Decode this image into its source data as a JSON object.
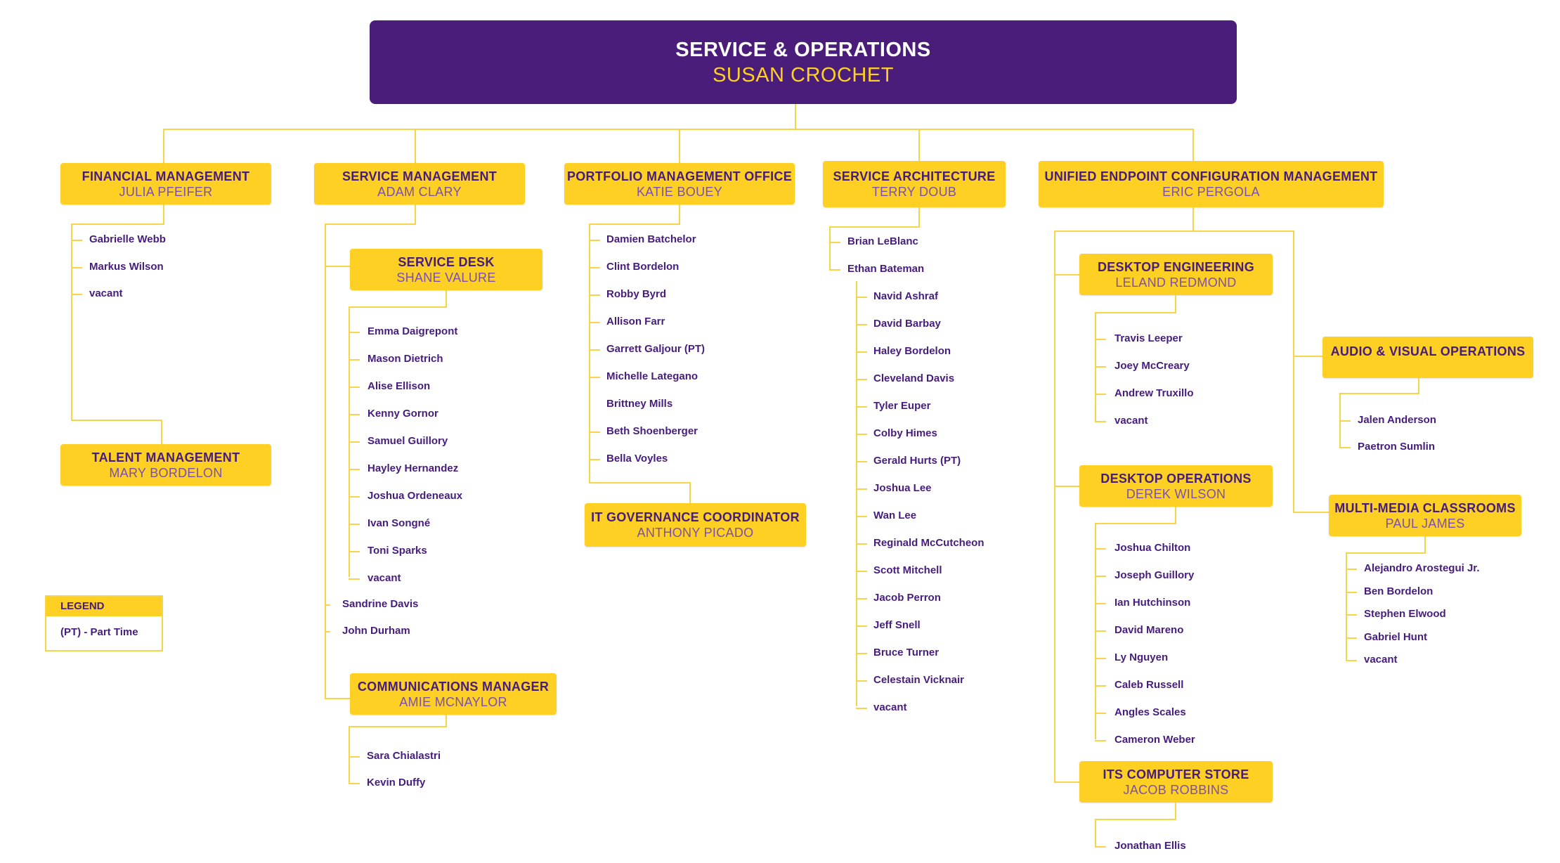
{
  "colors": {
    "header_bg": "#4a1d7a",
    "gold": "#fdd023",
    "text_purple": "#461d7c",
    "name_purple": "#7b4fb0",
    "connector": "#f7d44a"
  },
  "root": {
    "title": "SERVICE & OPERATIONS",
    "name": "SUSAN CROCHET"
  },
  "financial": {
    "title": "FINANCIAL MANAGEMENT",
    "name": "JULIA PFEIFER",
    "members": [
      "Gabrielle Webb",
      "Markus Wilson",
      "vacant"
    ],
    "talent": {
      "title": "TALENT MANAGEMENT",
      "name": "MARY BORDELON"
    }
  },
  "service_mgmt": {
    "title": "SERVICE MANAGEMENT",
    "name": "ADAM CLARY",
    "service_desk": {
      "title": "SERVICE DESK",
      "name": "SHANE VALURE",
      "members": [
        "Emma Daigrepont",
        "Mason Dietrich",
        "Alise Ellison",
        "Kenny Gornor",
        "Samuel Guillory",
        "Hayley Hernandez",
        "Joshua Ordeneaux",
        "Ivan Songné",
        "Toni Sparks",
        "vacant"
      ]
    },
    "members": [
      "Sandrine Davis",
      "John Durham"
    ],
    "comms": {
      "title": "COMMUNICATIONS MANAGER",
      "name": "AMIE MCNAYLOR",
      "members": [
        "Sara Chialastri",
        "Kevin Duffy"
      ]
    }
  },
  "pmo": {
    "title": "PORTFOLIO MANAGEMENT OFFICE",
    "name": "KATIE BOUEY",
    "members": [
      "Damien Batchelor",
      "Clint Bordelon",
      "Robby Byrd",
      "Allison Farr",
      "Garrett Galjour (PT)",
      "Michelle Lategano",
      "Brittney Mills",
      "Beth Shoenberger",
      "Bella Voyles"
    ],
    "itgov": {
      "title": "IT GOVERNANCE COORDINATOR",
      "name": "ANTHONY PICADO"
    }
  },
  "architecture": {
    "title": "SERVICE ARCHITECTURE",
    "name": "TERRY DOUB",
    "members": [
      "Brian LeBlanc",
      "Ethan Bateman"
    ],
    "sub_members": [
      "Navid Ashraf",
      "David Barbay",
      "Haley Bordelon",
      "Cleveland Davis",
      "Tyler Euper",
      "Colby Himes",
      "Gerald Hurts (PT)",
      "Joshua Lee",
      "Wan Lee",
      "Reginald McCutcheon",
      "Scott Mitchell",
      "Jacob Perron",
      "Jeff Snell",
      "Bruce Turner",
      "Celestain Vicknair",
      "vacant"
    ]
  },
  "uecm": {
    "title": "UNIFIED ENDPOINT CONFIGURATION MANAGEMENT",
    "name": "ERIC PERGOLA",
    "desktop_eng": {
      "title": "DESKTOP ENGINEERING",
      "name": "LELAND REDMOND",
      "members": [
        "Travis Leeper",
        "Joey McCreary",
        "Andrew Truxillo",
        "vacant"
      ]
    },
    "desktop_ops": {
      "title": "DESKTOP OPERATIONS",
      "name": "DEREK WILSON",
      "members": [
        "Joshua Chilton",
        "Joseph Guillory",
        "Ian Hutchinson",
        "David Mareno",
        "Ly Nguyen",
        "Caleb Russell",
        "Angles Scales",
        "Cameron Weber"
      ]
    },
    "store": {
      "title": "ITS COMPUTER STORE",
      "name": "JACOB ROBBINS",
      "members": [
        "Jonathan Ellis"
      ]
    },
    "av": {
      "title": "AUDIO & VISUAL OPERATIONS",
      "members": [
        "Jalen Anderson",
        "Paetron Sumlin"
      ]
    },
    "mmc": {
      "title": "MULTI-MEDIA CLASSROOMS",
      "name": "PAUL JAMES",
      "members": [
        "Alejandro Arostegui Jr.",
        "Ben Bordelon",
        "Stephen Elwood",
        "Gabriel Hunt",
        "vacant"
      ]
    }
  },
  "legend": {
    "title": "LEGEND",
    "items": [
      "(PT) - Part Time"
    ]
  }
}
